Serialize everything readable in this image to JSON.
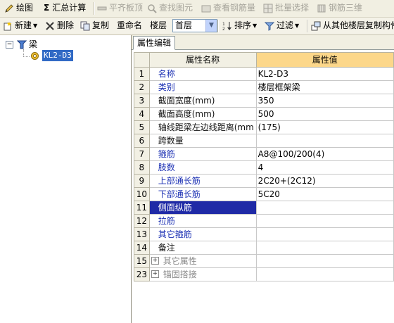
{
  "toolbar1": {
    "draw": "绘图",
    "sum_icon": "Σ",
    "summary_calc": "汇总计算",
    "flat_slab_top": "平齐板顶",
    "find_element": "查找图元",
    "view_rebar": "查看钢筋量",
    "batch_select": "批量选择",
    "rebar_3d": "钢筋三维"
  },
  "toolbar2": {
    "new": "新建",
    "delete": "删除",
    "copy": "复制",
    "rename": "重命名",
    "floor_label": "楼层",
    "floor_value": "首层",
    "sort": "排序",
    "filter": "过滤",
    "copy_from_floor": "从其他楼层复制构件"
  },
  "tree": {
    "root": "梁",
    "child": "KL2-D3"
  },
  "tab": "属性编辑",
  "table": {
    "headers": [
      "属性名称",
      "属性值"
    ],
    "rows": [
      {
        "num": "1",
        "name": "名称",
        "value": "KL2-D3",
        "style": "blue"
      },
      {
        "num": "2",
        "name": "类别",
        "value": "楼层框架梁",
        "style": "blue"
      },
      {
        "num": "3",
        "name": "截面宽度(mm)",
        "value": "350",
        "style": "black"
      },
      {
        "num": "4",
        "name": "截面高度(mm)",
        "value": "500",
        "style": "black"
      },
      {
        "num": "5",
        "name": "轴线距梁左边线距离(mm",
        "value": "(175)",
        "style": "black"
      },
      {
        "num": "6",
        "name": "跨数量",
        "value": "",
        "style": "black"
      },
      {
        "num": "7",
        "name": "箍筋",
        "value": "A8@100/200(4)",
        "style": "blue"
      },
      {
        "num": "8",
        "name": "肢数",
        "value": "4",
        "style": "blue"
      },
      {
        "num": "9",
        "name": "上部通长筋",
        "value": "2C20+(2C12)",
        "style": "blue"
      },
      {
        "num": "10",
        "name": "下部通长筋",
        "value": "5C20",
        "style": "blue"
      },
      {
        "num": "11",
        "name": "侧面纵筋",
        "value": "",
        "style": "sel"
      },
      {
        "num": "12",
        "name": "拉筋",
        "value": "",
        "style": "blue"
      },
      {
        "num": "13",
        "name": "其它箍筋",
        "value": "",
        "style": "blue"
      },
      {
        "num": "14",
        "name": "备注",
        "value": "",
        "style": "black"
      },
      {
        "num": "15",
        "name": "其它属性",
        "value": "",
        "style": "group"
      },
      {
        "num": "23",
        "name": "锚固搭接",
        "value": "",
        "style": "group"
      }
    ]
  },
  "colors": {
    "selection": "#1f2aa6",
    "header_highlight": "#fcd78a",
    "blue_text": "#1a2fb3"
  }
}
